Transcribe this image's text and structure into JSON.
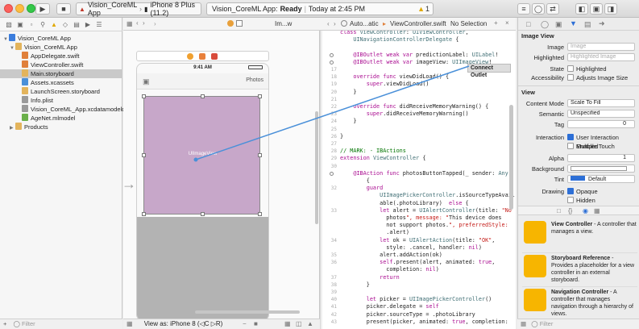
{
  "toolbar": {
    "scheme": "Vision_CoreML App",
    "device": "iPhone 8 Plus (11.2)",
    "status_project": "Vision_CoreML App:",
    "status_state": "Ready",
    "status_time": "Today at 2:45 PM",
    "warning_count": "1"
  },
  "navigator": {
    "items": [
      {
        "label": "Vision_CoreML App",
        "icon": "project-icon",
        "level": 0,
        "selected": false
      },
      {
        "label": "Vision_CoreML App",
        "icon": "folder-icon",
        "level": 1,
        "selected": false
      },
      {
        "label": "AppDelegate.swift",
        "icon": "swift-file-icon",
        "level": 2,
        "selected": false
      },
      {
        "label": "ViewController.swift",
        "icon": "swift-file-icon",
        "level": 2,
        "selected": false
      },
      {
        "label": "Main.storyboard",
        "icon": "storyboard-icon",
        "level": 2,
        "selected": true
      },
      {
        "label": "Assets.xcassets",
        "icon": "assets-icon",
        "level": 2,
        "selected": false
      },
      {
        "label": "LaunchScreen.storyboard",
        "icon": "storyboard-icon",
        "level": 2,
        "selected": false
      },
      {
        "label": "Info.plist",
        "icon": "plist-icon",
        "level": 2,
        "selected": false
      },
      {
        "label": "Vision_CoreML_App.xcdatamodeld",
        "icon": "datamodel-icon",
        "level": 2,
        "selected": false
      },
      {
        "label": "AgeNet.mlmodel",
        "icon": "mlmodel-icon",
        "level": 2,
        "selected": false
      },
      {
        "label": "Products",
        "icon": "folder-icon",
        "level": 1,
        "selected": false
      }
    ],
    "filter_placeholder": "Filter"
  },
  "jumpbar": {
    "crumb1": "Im...w",
    "crumb2": "Auto...atic",
    "crumb3": "ViewController.swift",
    "crumb4": "No Selection"
  },
  "canvas": {
    "status_time": "9:41 AM",
    "nav_title": "Photos",
    "image_view_label": "UIImageView",
    "view_as": "View as: iPhone 8 (◁C ▷R)"
  },
  "code": {
    "lines": [
      {
        "n": "",
        "t": "class ViewController: UIViewController,",
        "dot": false
      },
      {
        "n": "",
        "t": "    UINavigationControllerDelegate {",
        "dot": false
      },
      {
        "n": "",
        "t": "",
        "dot": false
      },
      {
        "n": "",
        "t": "    @IBOutlet weak var predictionLabel: UILabel!",
        "dot": true
      },
      {
        "n": "",
        "t": "    @IBOutlet weak var imageView: UIImageView!",
        "dot": true
      },
      {
        "n": "17",
        "t": "",
        "dot": false
      },
      {
        "n": "18",
        "t": "    override func viewDidLoad() {",
        "dot": false
      },
      {
        "n": "19",
        "t": "        super.viewDidLoad()",
        "dot": false
      },
      {
        "n": "20",
        "t": "    }",
        "dot": false
      },
      {
        "n": "21",
        "t": "",
        "dot": false
      },
      {
        "n": "22",
        "t": "    override func didReceiveMemoryWarning() {",
        "dot": false
      },
      {
        "n": "23",
        "t": "        super.didReceiveMemoryWarning()",
        "dot": false
      },
      {
        "n": "24",
        "t": "    }",
        "dot": false
      },
      {
        "n": "25",
        "t": "",
        "dot": false
      },
      {
        "n": "26",
        "t": "}",
        "dot": false
      },
      {
        "n": "27",
        "t": "",
        "dot": false
      },
      {
        "n": "28",
        "t": "// MARK: - IBActions",
        "dot": false
      },
      {
        "n": "29",
        "t": "extension ViewController {",
        "dot": false
      },
      {
        "n": "30",
        "t": "",
        "dot": false
      },
      {
        "n": "",
        "t": "    @IBAction func photosButtonTapped(_ sender: Any)",
        "dot": true
      },
      {
        "n": "",
        "t": "        {",
        "dot": false
      },
      {
        "n": "32",
        "t": "        guard",
        "dot": false
      },
      {
        "n": "",
        "t": "            UIImagePickerController.isSourceTypeAvail",
        "dot": false
      },
      {
        "n": "",
        "t": "            able(.photoLibrary)  else {",
        "dot": false
      },
      {
        "n": "33",
        "t": "            let alert = UIAlertController(title: \"No",
        "dot": false
      },
      {
        "n": "",
        "t": "              photos\", message: \"This device does",
        "dot": false
      },
      {
        "n": "",
        "t": "              not support photos.\", preferredStyle:",
        "dot": false
      },
      {
        "n": "",
        "t": "              .alert)",
        "dot": false
      },
      {
        "n": "34",
        "t": "            let ok = UIAlertAction(title: \"OK\",",
        "dot": false
      },
      {
        "n": "",
        "t": "              style: .cancel, handler: nil)",
        "dot": false
      },
      {
        "n": "35",
        "t": "            alert.addAction(ok)",
        "dot": false
      },
      {
        "n": "36",
        "t": "            self.present(alert, animated: true,",
        "dot": false
      },
      {
        "n": "",
        "t": "              completion: nil)",
        "dot": false
      },
      {
        "n": "37",
        "t": "            return",
        "dot": false
      },
      {
        "n": "38",
        "t": "        }",
        "dot": false
      },
      {
        "n": "39",
        "t": "",
        "dot": false
      },
      {
        "n": "40",
        "t": "        let picker = UIImagePickerController()",
        "dot": false
      },
      {
        "n": "41",
        "t": "        picker.delegate = self",
        "dot": false
      },
      {
        "n": "42",
        "t": "        picker.sourceType = .photoLibrary",
        "dot": false
      },
      {
        "n": "43",
        "t": "        present(picker, animated: true, completion:",
        "dot": false
      }
    ],
    "connect_tooltip": "Connect Outlet"
  },
  "inspector": {
    "section_image_view": "Image View",
    "image_label": "Image",
    "image_placeholder": "Image",
    "highlighted_label": "Highlighted",
    "highlighted_placeholder": "Highlighted Image",
    "state_label": "State",
    "state_value": "Highlighted",
    "accessibility_label": "Accessibility",
    "accessibility_value": "Adjusts Image Size",
    "section_view": "View",
    "content_mode_label": "Content Mode",
    "content_mode_value": "Scale To Fill",
    "semantic_label": "Semantic",
    "semantic_value": "Unspecified",
    "tag_label": "Tag",
    "tag_value": "0",
    "interaction_label": "Interaction",
    "user_interaction": "User Interaction Enabled",
    "multiple_touch": "Multiple Touch",
    "alpha_label": "Alpha",
    "alpha_value": "1",
    "background_label": "Background",
    "tint_label": "Tint",
    "tint_value": "Default",
    "drawing_label": "Drawing",
    "opaque": "Opaque",
    "hidden": "Hidden",
    "filter_placeholder": "Filter"
  },
  "library": [
    {
      "title": "View Controller",
      "desc": " - A controller that manages a view.",
      "color": "#f7b500"
    },
    {
      "title": "Storyboard Reference",
      "desc": " - Provides a placeholder for a view controller in an external storyboard.",
      "color": "#f7b500"
    },
    {
      "title": "Navigation Controller",
      "desc": " - A controller that manages navigation through a hierarchy of views.",
      "color": "#f7b500"
    }
  ],
  "colors": {
    "accent": "#2d6fd6",
    "image_view_fill": "#c7a7c9",
    "connect_line": "#4a90d9"
  }
}
